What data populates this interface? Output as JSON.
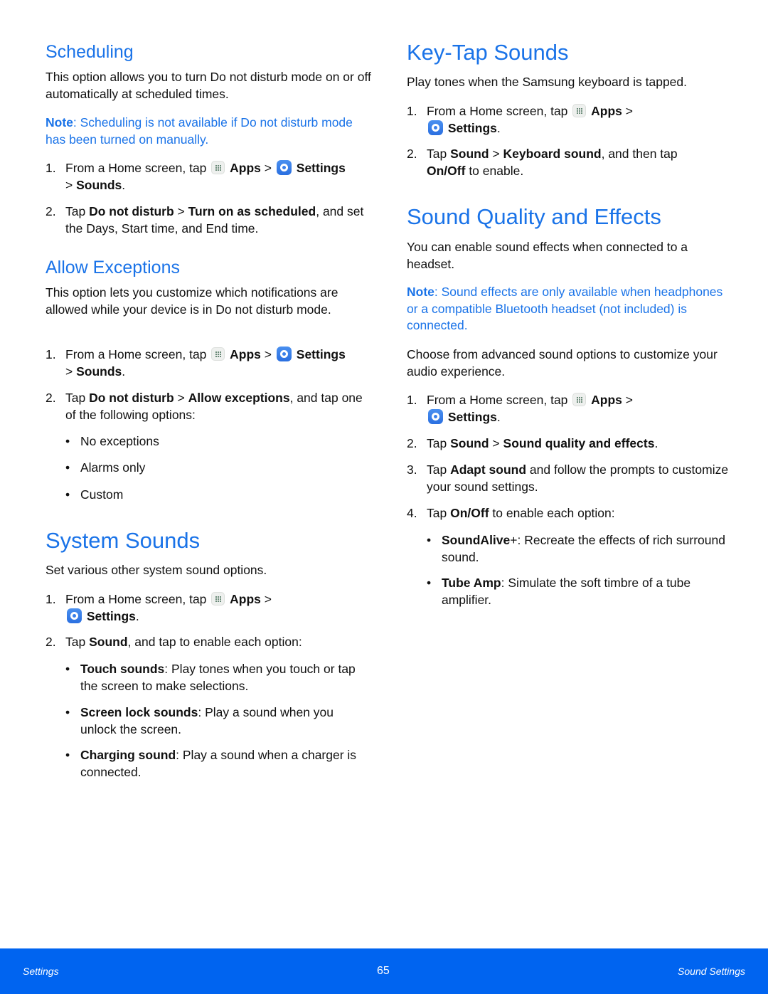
{
  "left": {
    "scheduling": {
      "title": "Scheduling",
      "desc": "This option allows you to turn Do not disturb mode on or off automatically at scheduled times.",
      "note_label": "Note",
      "note_text": ": Scheduling is not available if Do not disturb mode has been turned on manually.",
      "steps": [
        {
          "num": "1.",
          "pre": "From a Home screen, tap",
          "apps": "Apps",
          "sep": ">",
          "settings": "Settings",
          "sep2": ">",
          "target": "Sounds",
          "end": "."
        },
        {
          "num": "2.",
          "pre": "Tap",
          "b1": "Do not disturb",
          "sep": ">",
          "b2": "Turn on as scheduled",
          "post": ", and set the Days, Start time, and End time."
        }
      ]
    },
    "allow_exceptions": {
      "title": "Allow Exceptions",
      "desc": "This option lets you customize which notifications are allowed while your device is in Do not disturb mode.",
      "steps": [
        {
          "num": "1.",
          "pre": "From a Home screen, tap",
          "apps": "Apps",
          "sep": ">",
          "settings": "Settings",
          "sep2": ">",
          "target": "Sounds",
          "end": "."
        },
        {
          "num": "2.",
          "pre": "Tap",
          "b1": "Do not disturb",
          "sep": ">",
          "b2": "Allow exceptions",
          "post": ", and tap one of the following options:"
        }
      ],
      "options": [
        "No exceptions",
        "Alarms only",
        "Custom"
      ]
    },
    "system_sounds": {
      "title": "System Sounds",
      "desc": "Set various other system sound options.",
      "steps": [
        {
          "num": "1.",
          "pre": "From a Home screen, tap",
          "apps": "Apps",
          "sep": ">",
          "settings": "Settings",
          "end": "."
        },
        {
          "num": "2.",
          "pre": "Tap",
          "b1": "Sound",
          "post": ", and tap to enable each option:"
        }
      ],
      "options": [
        {
          "term": "Touch sounds",
          "desc": ": Play tones when you touch or tap the screen to make selections."
        },
        {
          "term": "Screen lock sounds",
          "desc": ": Play a sound when you unlock the screen."
        },
        {
          "term": "Charging sound",
          "desc": ": Play a sound when a charger is connected."
        }
      ]
    }
  },
  "right": {
    "key_tap": {
      "title": "Key-Tap Sounds",
      "desc": "Play tones when the Samsung keyboard is tapped.",
      "steps": [
        {
          "num": "1.",
          "pre": "From a Home screen, tap",
          "apps": "Apps",
          "sep": ">",
          "settings": "Settings",
          "end": "."
        },
        {
          "num": "2.",
          "pre": "Tap",
          "b1": "Sound",
          "sep": ">",
          "b2": "Keyboard sound",
          "mid": ", and then tap",
          "b3": "On/Off",
          "post": "to enable."
        }
      ]
    },
    "quality": {
      "title": "Sound Quality and Effects",
      "desc": "You can enable sound effects when connected to a headset.",
      "note_label": "Note",
      "note_text": ": Sound effects are only available when headphones or a compatible Bluetooth headset (not included) is connected.",
      "desc2": "Choose from advanced sound options to customize your audio experience.",
      "steps": [
        {
          "num": "1.",
          "pre": "From a Home screen, tap",
          "apps": "Apps",
          "sep": ">",
          "settings": "Settings",
          "end": "."
        },
        {
          "num": "2.",
          "pre": "Tap",
          "b1": "Sound",
          "sep": ">",
          "b2": "Sound quality and effects",
          "end": "."
        },
        {
          "num": "3.",
          "pre": "Tap",
          "b1": "Adapt sound",
          "post": "and follow the prompts to customize your sound settings."
        },
        {
          "num": "4.",
          "pre": "Tap",
          "b1": "On/Off",
          "post": "to enable each option:"
        }
      ],
      "options": [
        {
          "term": "SoundAlive",
          "plus": "+",
          "desc": ": Recreate the effects of rich surround sound."
        },
        {
          "term": "Tube Amp",
          "desc": ": Simulate the soft timbre of a tube amplifier."
        }
      ]
    }
  },
  "footer": {
    "left": "Settings",
    "page": "65",
    "right": "Sound Settings"
  },
  "colors": {
    "accent": "#1a73e8",
    "footer_bg": "#0064f0"
  }
}
